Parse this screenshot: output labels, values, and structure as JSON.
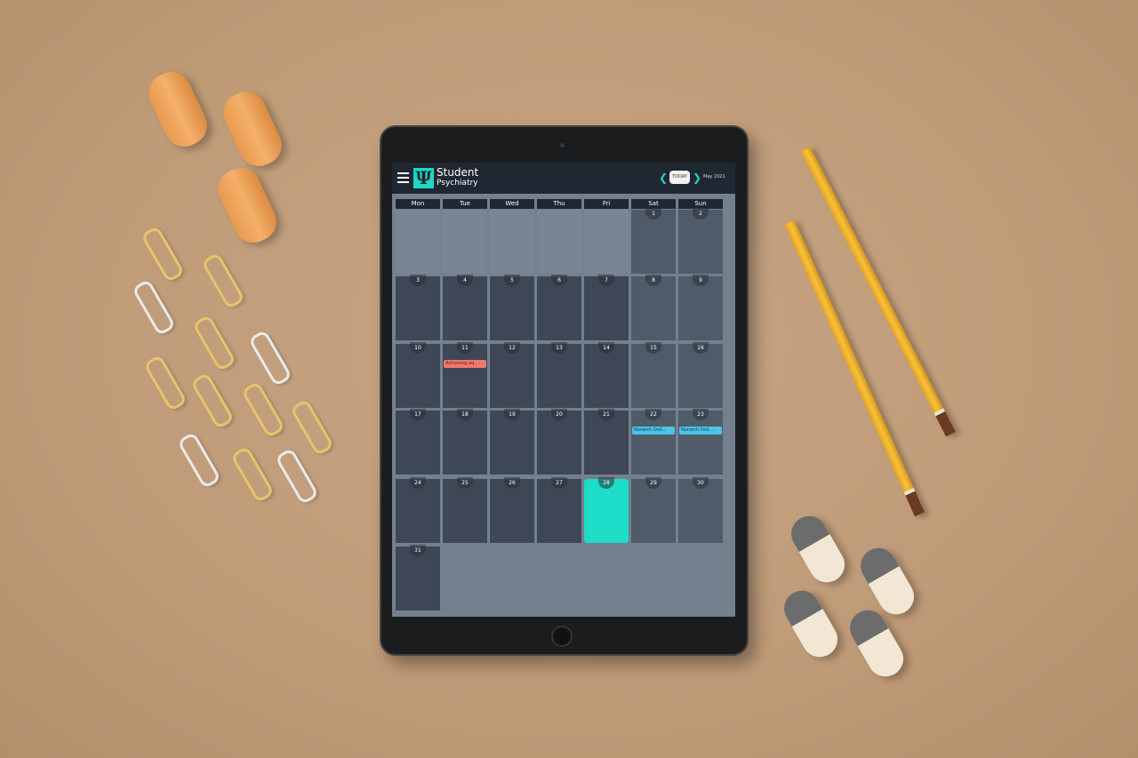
{
  "app": {
    "brand_line1": "Student",
    "brand_line2": "Psychiatry",
    "logo_glyph": "Ψ",
    "accent": "#1fd7c4"
  },
  "toolbar": {
    "prev_icon": "chevron-left",
    "today_label": "TODAY",
    "next_icon": "chevron-right",
    "month_label": "May 2021"
  },
  "weekdays": [
    "Mon",
    "Tue",
    "Wed",
    "Thu",
    "Fri",
    "Sat",
    "Sun"
  ],
  "calendar": {
    "leading_empty_days": 5,
    "days_in_month": 31,
    "today": 28,
    "today_color": "#1ddcc8",
    "events": [
      {
        "day": 11,
        "title": "Achieving eq...",
        "color": "#f0786c"
      },
      {
        "day": 22,
        "title": "Norwich Onli...",
        "color": "#4cc3e8"
      },
      {
        "day": 23,
        "title": "Norwich Onli...",
        "color": "#4cc3e8"
      }
    ]
  }
}
